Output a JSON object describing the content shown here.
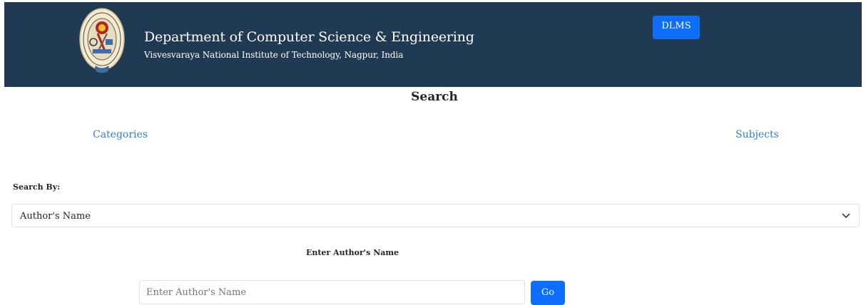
{
  "header": {
    "department_title": "Department of Computer Science & Engineering",
    "institute_subtitle": "Visvesvaraya National Institute of Technology, Nagpur, India",
    "logo_icon": "institute-emblem-icon",
    "dlms_label": "DLMS"
  },
  "page": {
    "title": "Search"
  },
  "nav": {
    "categories_label": "Categories",
    "subjects_label": "Subjects"
  },
  "search": {
    "search_by_label": "Search By:",
    "selected_option": "Author's Name",
    "field_heading": "Enter Author's Name",
    "input_placeholder": "Enter Author's Name",
    "input_value": "",
    "go_label": "Go"
  },
  "colors": {
    "header_background": "#1f3a52",
    "button_primary": "#0d6efd",
    "link": "#2e7fd6"
  }
}
